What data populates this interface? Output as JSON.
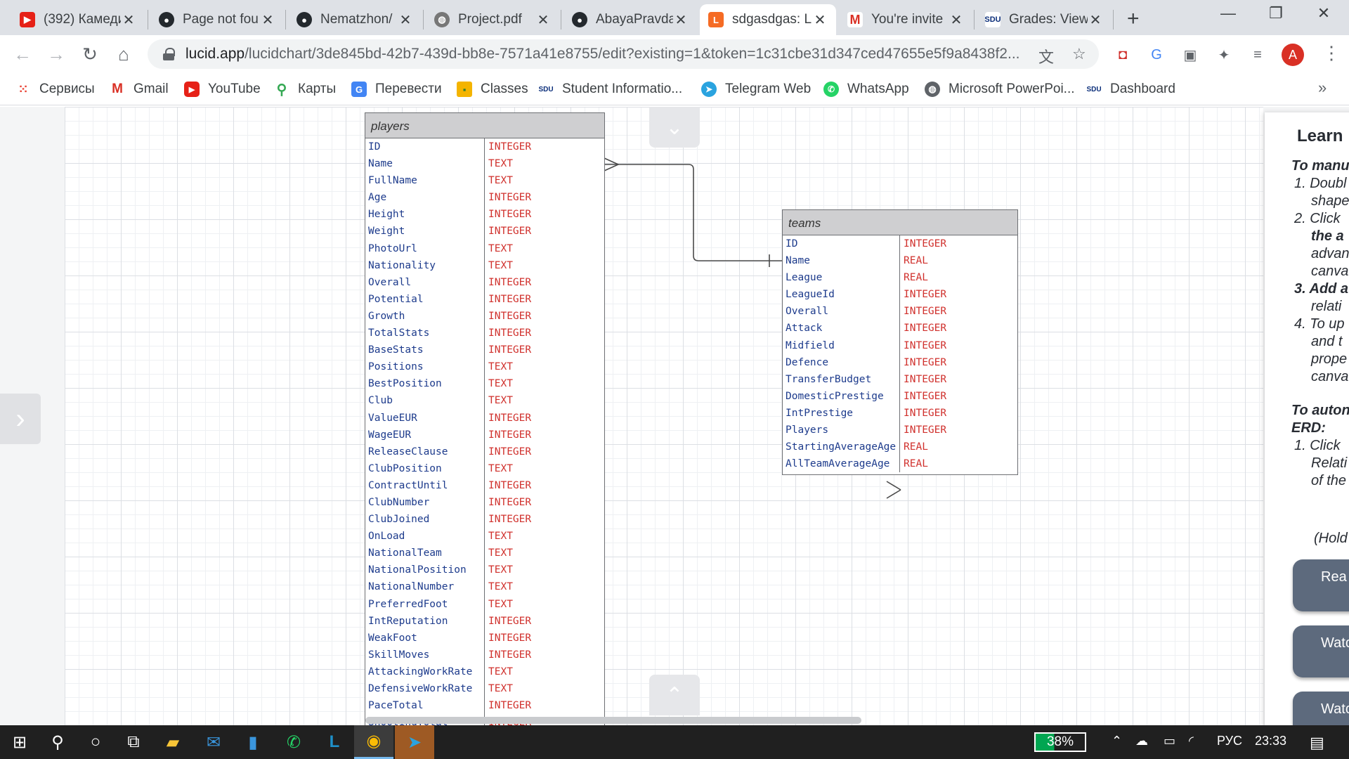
{
  "tabs": [
    {
      "title": "(392) Камеди",
      "favicon": "youtube-icon"
    },
    {
      "title": "Page not fou",
      "favicon": "github-icon"
    },
    {
      "title": "Nematzhon/",
      "favicon": "github-icon"
    },
    {
      "title": "Project.pdf",
      "favicon": "globe-icon"
    },
    {
      "title": "AbayaPravda",
      "favicon": "github-icon"
    },
    {
      "title": "sdgasdgas: L",
      "favicon": "lucidchart-icon",
      "active": true
    },
    {
      "title": "You're invite",
      "favicon": "gmail-icon"
    },
    {
      "title": "Grades: View",
      "favicon": "sdu-icon"
    }
  ],
  "toolbar": {
    "url_host": "lucid.app",
    "url_path": "/lucidchart/3de845bd-42b7-439d-bb8e-7571a41e8755/edit?existing=1&token=1c31cbe31d347ced47655e5f9a8438f2..."
  },
  "profile": {
    "initial": "A"
  },
  "bookmarks": [
    {
      "label": "Сервисы",
      "icon": "apps-grid-icon"
    },
    {
      "label": "Gmail",
      "icon": "gmail-icon"
    },
    {
      "label": "YouTube",
      "icon": "youtube-icon"
    },
    {
      "label": "Карты",
      "icon": "maps-pin-icon"
    },
    {
      "label": "Перевести",
      "icon": "translate-icon"
    },
    {
      "label": "Classes",
      "icon": "classroom-icon"
    },
    {
      "label": "Student Informatio...",
      "icon": "sdu-icon"
    },
    {
      "label": "Telegram Web",
      "icon": "telegram-icon"
    },
    {
      "label": "WhatsApp",
      "icon": "whatsapp-icon"
    },
    {
      "label": "Microsoft PowerPoi...",
      "icon": "globe-icon"
    },
    {
      "label": "Dashboard",
      "icon": "sdu-icon"
    }
  ],
  "players_table": {
    "title": "players",
    "rows": [
      {
        "name": "ID",
        "type": "INTEGER"
      },
      {
        "name": "Name",
        "type": "TEXT"
      },
      {
        "name": "FullName",
        "type": "TEXT"
      },
      {
        "name": "Age",
        "type": "INTEGER"
      },
      {
        "name": "Height",
        "type": "INTEGER"
      },
      {
        "name": "Weight",
        "type": "INTEGER"
      },
      {
        "name": "PhotoUrl",
        "type": "TEXT"
      },
      {
        "name": "Nationality",
        "type": "TEXT"
      },
      {
        "name": "Overall",
        "type": "INTEGER"
      },
      {
        "name": "Potential",
        "type": "INTEGER"
      },
      {
        "name": "Growth",
        "type": "INTEGER"
      },
      {
        "name": "TotalStats",
        "type": "INTEGER"
      },
      {
        "name": "BaseStats",
        "type": "INTEGER"
      },
      {
        "name": "Positions",
        "type": "TEXT"
      },
      {
        "name": "BestPosition",
        "type": "TEXT"
      },
      {
        "name": "Club",
        "type": "TEXT"
      },
      {
        "name": "ValueEUR",
        "type": "INTEGER"
      },
      {
        "name": "WageEUR",
        "type": "INTEGER"
      },
      {
        "name": "ReleaseClause",
        "type": "INTEGER"
      },
      {
        "name": "ClubPosition",
        "type": "TEXT"
      },
      {
        "name": "ContractUntil",
        "type": "INTEGER"
      },
      {
        "name": "ClubNumber",
        "type": "INTEGER"
      },
      {
        "name": "ClubJoined",
        "type": "INTEGER"
      },
      {
        "name": "OnLoad",
        "type": "TEXT"
      },
      {
        "name": "NationalTeam",
        "type": "TEXT"
      },
      {
        "name": "NationalPosition",
        "type": "TEXT"
      },
      {
        "name": "NationalNumber",
        "type": "TEXT"
      },
      {
        "name": "PreferredFoot",
        "type": "TEXT"
      },
      {
        "name": "IntReputation",
        "type": "INTEGER"
      },
      {
        "name": "WeakFoot",
        "type": "INTEGER"
      },
      {
        "name": "SkillMoves",
        "type": "INTEGER"
      },
      {
        "name": "AttackingWorkRate",
        "type": "TEXT"
      },
      {
        "name": "DefensiveWorkRate",
        "type": "TEXT"
      },
      {
        "name": "PaceTotal",
        "type": "INTEGER"
      },
      {
        "name": "ShootingTotal",
        "type": "INTEGER"
      }
    ]
  },
  "teams_table": {
    "title": "teams",
    "rows": [
      {
        "name": "ID",
        "type": "INTEGER"
      },
      {
        "name": "Name",
        "type": "REAL"
      },
      {
        "name": "League",
        "type": "REAL"
      },
      {
        "name": "LeagueId",
        "type": "INTEGER"
      },
      {
        "name": "Overall",
        "type": "INTEGER"
      },
      {
        "name": "Attack",
        "type": "INTEGER"
      },
      {
        "name": "Midfield",
        "type": "INTEGER"
      },
      {
        "name": "Defence",
        "type": "INTEGER"
      },
      {
        "name": "TransferBudget",
        "type": "INTEGER"
      },
      {
        "name": "DomesticPrestige",
        "type": "INTEGER"
      },
      {
        "name": "IntPrestige",
        "type": "INTEGER"
      },
      {
        "name": "Players",
        "type": "INTEGER"
      },
      {
        "name": "StartingAverageAge",
        "type": "REAL"
      },
      {
        "name": "AllTeamAverageAge",
        "type": "REAL"
      }
    ]
  },
  "learn_panel": {
    "title": "Learn",
    "lines": [
      "To manu",
      "1.  Doubl",
      "shape",
      "2.  Click",
      "the a",
      "advan",
      "canva",
      "3.  Add a",
      "relati",
      "4.  To up",
      "and t",
      "prope",
      "canva",
      "To auton",
      "ERD:",
      "1.  Click",
      "Relati",
      "of the",
      "(Hold"
    ],
    "buttons": [
      "Rea",
      "Watc",
      "Watc"
    ]
  },
  "taskbar": {
    "battery": "38%",
    "language": "РУС",
    "time": "23:33"
  }
}
